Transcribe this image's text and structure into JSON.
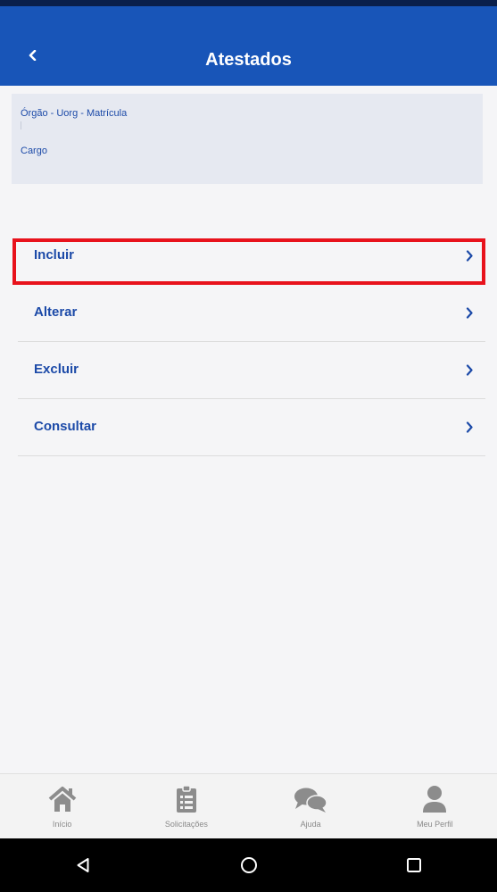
{
  "header": {
    "title": "Atestados",
    "back_icon": "chevron-left-icon",
    "background_color": "#1855b8"
  },
  "info_card": {
    "line1": "Órgão - Uorg - Matrícula",
    "line2": "Cargo"
  },
  "menu": {
    "items": [
      {
        "label": "Incluir",
        "icon": "chevron-right-icon",
        "highlighted": true
      },
      {
        "label": "Alterar",
        "icon": "chevron-right-icon"
      },
      {
        "label": "Excluir",
        "icon": "chevron-right-icon"
      },
      {
        "label": "Consultar",
        "icon": "chevron-right-icon"
      }
    ],
    "label_color": "#1c4aa8",
    "highlight_color": "#e8121c"
  },
  "bottom_nav": {
    "tabs": [
      {
        "label": "Início",
        "icon": "home-icon"
      },
      {
        "label": "Solicitações",
        "icon": "clipboard-list-icon"
      },
      {
        "label": "Ajuda",
        "icon": "chat-bubbles-icon"
      },
      {
        "label": "Meu Perfil",
        "icon": "user-icon"
      }
    ]
  },
  "system_nav": {
    "buttons": [
      "back-triangle-icon",
      "home-circle-icon",
      "recents-square-icon"
    ]
  }
}
